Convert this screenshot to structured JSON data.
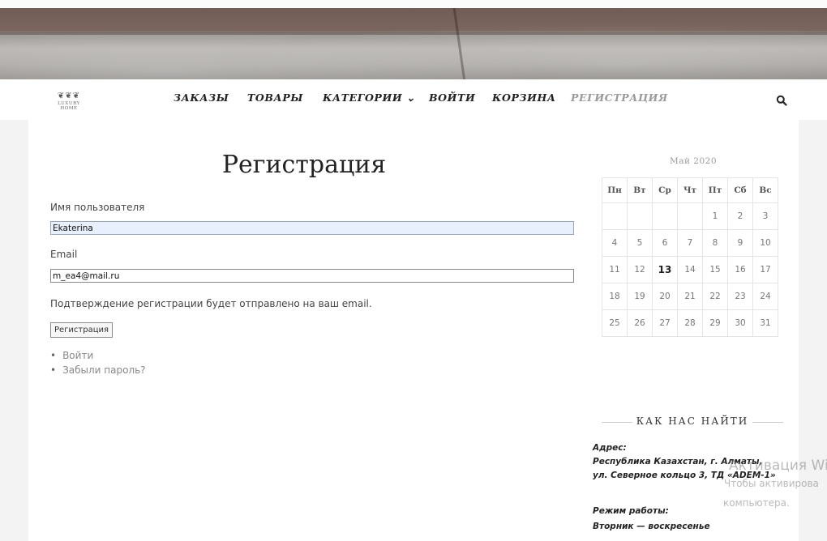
{
  "logo": {
    "text": "LUXURY HOME"
  },
  "nav": {
    "items": [
      {
        "label": "ЗАКАЗЫ"
      },
      {
        "label": "ТОВАРЫ"
      },
      {
        "label": "КАТЕГОРИИ ⌄"
      },
      {
        "label": "ВОЙТИ"
      },
      {
        "label": "КОРЗИНА"
      },
      {
        "label": "РЕГИСТРАЦИЯ",
        "active": true
      }
    ]
  },
  "form": {
    "title": "Регистрация",
    "username_label": "Имя пользователя",
    "username_value": "Ekaterina",
    "email_label": "Email",
    "email_value": "m_ea4@mail.ru",
    "note": "Подтверждение регистрации будет отправлено на ваш email.",
    "submit_label": "Регистрация",
    "links": [
      "Войти",
      "Забыли пароль?"
    ]
  },
  "calendar": {
    "caption": "Май 2020",
    "weekdays": [
      "Пн",
      "Вт",
      "Ср",
      "Чт",
      "Пт",
      "Сб",
      "Вс"
    ],
    "weeks": [
      [
        "",
        "",
        "",
        "",
        "1",
        "2",
        "3"
      ],
      [
        "4",
        "5",
        "6",
        "7",
        "8",
        "9",
        "10"
      ],
      [
        "11",
        "12",
        "13",
        "14",
        "15",
        "16",
        "17"
      ],
      [
        "18",
        "19",
        "20",
        "21",
        "22",
        "23",
        "24"
      ],
      [
        "25",
        "26",
        "27",
        "28",
        "29",
        "30",
        "31"
      ]
    ],
    "today": "13"
  },
  "find_us": {
    "heading": "КАК НАС НАЙТИ",
    "address_label": "Адрес:",
    "address_line1": "Республика Казахстан, г. Алматы,",
    "address_line2": "ул. Северное кольцо 3, ТД «ADEM-1»",
    "hours_label": "Режим работы:",
    "hours_line1": "Вторник — воскресенье"
  },
  "watermark": {
    "line1": "Активация Wi",
    "line2": "Чтобы активирова",
    "line3": "компьютера."
  },
  "colors": {
    "active_nav": "#9a9a9a",
    "autofill": "#e8f0fe"
  }
}
